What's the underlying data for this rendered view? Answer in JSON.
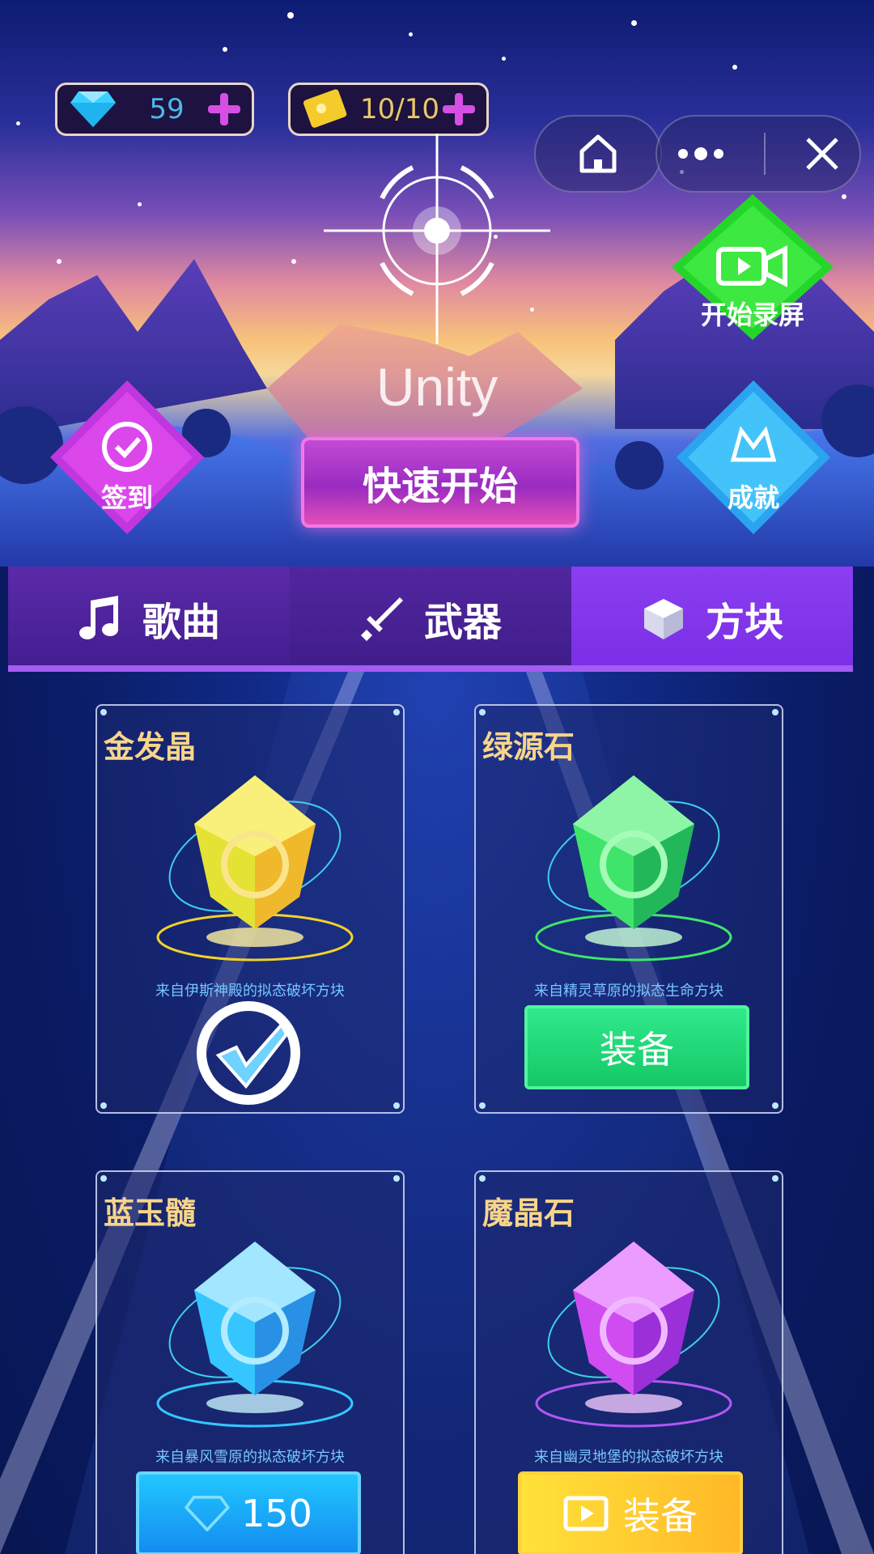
{
  "top_bar": {
    "gems": "59",
    "tickets": "10/10"
  },
  "game": {
    "title": "Unity",
    "quick_start": "快速开始",
    "record": "开始录屏",
    "checkin": "签到",
    "achievement": "成就"
  },
  "tabs": [
    {
      "label": "歌曲",
      "icon": "music-note-icon"
    },
    {
      "label": "武器",
      "icon": "sword-icon"
    },
    {
      "label": "方块",
      "icon": "cube-icon"
    }
  ],
  "active_tab": "方块",
  "cards": [
    {
      "name": "金发晶",
      "desc": "来自伊斯神殿的拟态破坏方块",
      "state": "equipped",
      "color": "#f2d22a"
    },
    {
      "name": "绿源石",
      "desc": "来自精灵草原的拟态生命方块",
      "state": "equip",
      "action_label": "装备",
      "color": "#3fe56a"
    },
    {
      "name": "蓝玉髓",
      "desc": "来自暴风雪原的拟态破坏方块",
      "state": "buy",
      "action_label": "150",
      "color": "#35c6ff"
    },
    {
      "name": "魔晶石",
      "desc": "来自幽灵地堡的拟态破坏方块",
      "state": "ad_equip",
      "action_label": "装备",
      "color": "#d04cf0"
    }
  ]
}
